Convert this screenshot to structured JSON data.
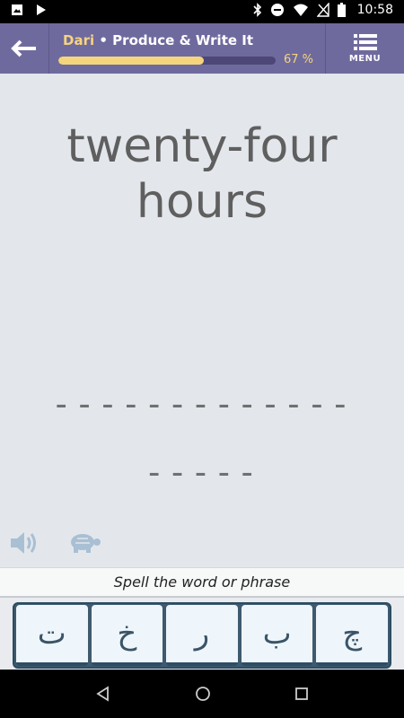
{
  "status_bar": {
    "time": "10:58",
    "left_icons": [
      "image-icon",
      "play-store-icon"
    ],
    "right_icons": [
      "bluetooth-icon",
      "do-not-disturb-icon",
      "wifi-icon",
      "no-signal-icon",
      "battery-icon"
    ]
  },
  "header": {
    "language": "Dari",
    "separator": " • ",
    "activity": "Produce & Write It",
    "progress_percent": 67,
    "progress_label": "67 %",
    "menu_label": "MENU"
  },
  "prompt": {
    "line1": "twenty-four",
    "line2": "hours"
  },
  "answer_blanks": {
    "line1": "-------------",
    "line2": "-----"
  },
  "audio": {
    "icons": [
      "speaker-icon",
      "turtle-slow-icon"
    ]
  },
  "instruction": "Spell the word or phrase",
  "keyboard": {
    "keys": [
      "ت",
      "خ",
      "ر",
      "ب",
      "چ"
    ]
  },
  "colors": {
    "header_bg": "#6f6a9e",
    "accent_yellow": "#f4d57c",
    "key_border": "#2f4d63",
    "key_bg": "#eef6fb"
  }
}
